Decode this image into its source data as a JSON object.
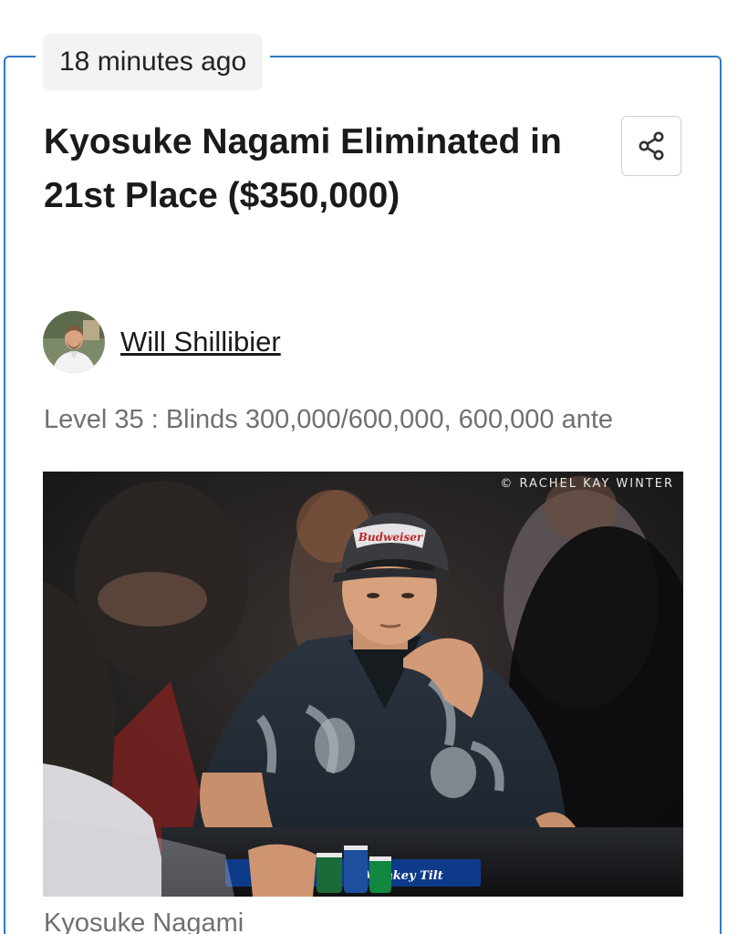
{
  "post": {
    "timestamp": "18 minutes ago",
    "title": "Kyosuke Nagami Eliminated in 21st Place ($350,000)",
    "author": "Will Shillibier",
    "level_info": "Level 35 : Blinds 300,000/600,000, 600,000 ante",
    "photo_credit": "© RACHEL KAY WINTER",
    "photo_caption": "Kyosuke Nagami",
    "cap_text": "Budweiser",
    "table_brand": "Monkey Tilt"
  },
  "icons": {
    "share": "share-icon"
  },
  "colors": {
    "card_border": "#2f78c8",
    "text": "#1a1a1a",
    "muted_text": "#707070",
    "chip_bg": "#f3f3f3"
  }
}
